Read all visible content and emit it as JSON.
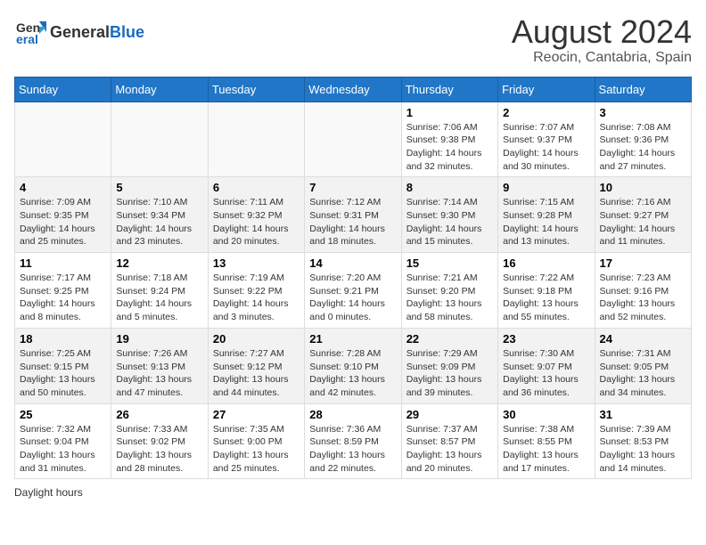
{
  "header": {
    "logo_general": "General",
    "logo_blue": "Blue",
    "title": "August 2024",
    "subtitle": "Reocin, Cantabria, Spain"
  },
  "weekdays": [
    "Sunday",
    "Monday",
    "Tuesday",
    "Wednesday",
    "Thursday",
    "Friday",
    "Saturday"
  ],
  "weeks": [
    [
      {
        "day": "",
        "info": ""
      },
      {
        "day": "",
        "info": ""
      },
      {
        "day": "",
        "info": ""
      },
      {
        "day": "",
        "info": ""
      },
      {
        "day": "1",
        "info": "Sunrise: 7:06 AM\nSunset: 9:38 PM\nDaylight: 14 hours\nand 32 minutes."
      },
      {
        "day": "2",
        "info": "Sunrise: 7:07 AM\nSunset: 9:37 PM\nDaylight: 14 hours\nand 30 minutes."
      },
      {
        "day": "3",
        "info": "Sunrise: 7:08 AM\nSunset: 9:36 PM\nDaylight: 14 hours\nand 27 minutes."
      }
    ],
    [
      {
        "day": "4",
        "info": "Sunrise: 7:09 AM\nSunset: 9:35 PM\nDaylight: 14 hours\nand 25 minutes."
      },
      {
        "day": "5",
        "info": "Sunrise: 7:10 AM\nSunset: 9:34 PM\nDaylight: 14 hours\nand 23 minutes."
      },
      {
        "day": "6",
        "info": "Sunrise: 7:11 AM\nSunset: 9:32 PM\nDaylight: 14 hours\nand 20 minutes."
      },
      {
        "day": "7",
        "info": "Sunrise: 7:12 AM\nSunset: 9:31 PM\nDaylight: 14 hours\nand 18 minutes."
      },
      {
        "day": "8",
        "info": "Sunrise: 7:14 AM\nSunset: 9:30 PM\nDaylight: 14 hours\nand 15 minutes."
      },
      {
        "day": "9",
        "info": "Sunrise: 7:15 AM\nSunset: 9:28 PM\nDaylight: 14 hours\nand 13 minutes."
      },
      {
        "day": "10",
        "info": "Sunrise: 7:16 AM\nSunset: 9:27 PM\nDaylight: 14 hours\nand 11 minutes."
      }
    ],
    [
      {
        "day": "11",
        "info": "Sunrise: 7:17 AM\nSunset: 9:25 PM\nDaylight: 14 hours\nand 8 minutes."
      },
      {
        "day": "12",
        "info": "Sunrise: 7:18 AM\nSunset: 9:24 PM\nDaylight: 14 hours\nand 5 minutes."
      },
      {
        "day": "13",
        "info": "Sunrise: 7:19 AM\nSunset: 9:22 PM\nDaylight: 14 hours\nand 3 minutes."
      },
      {
        "day": "14",
        "info": "Sunrise: 7:20 AM\nSunset: 9:21 PM\nDaylight: 14 hours\nand 0 minutes."
      },
      {
        "day": "15",
        "info": "Sunrise: 7:21 AM\nSunset: 9:20 PM\nDaylight: 13 hours\nand 58 minutes."
      },
      {
        "day": "16",
        "info": "Sunrise: 7:22 AM\nSunset: 9:18 PM\nDaylight: 13 hours\nand 55 minutes."
      },
      {
        "day": "17",
        "info": "Sunrise: 7:23 AM\nSunset: 9:16 PM\nDaylight: 13 hours\nand 52 minutes."
      }
    ],
    [
      {
        "day": "18",
        "info": "Sunrise: 7:25 AM\nSunset: 9:15 PM\nDaylight: 13 hours\nand 50 minutes."
      },
      {
        "day": "19",
        "info": "Sunrise: 7:26 AM\nSunset: 9:13 PM\nDaylight: 13 hours\nand 47 minutes."
      },
      {
        "day": "20",
        "info": "Sunrise: 7:27 AM\nSunset: 9:12 PM\nDaylight: 13 hours\nand 44 minutes."
      },
      {
        "day": "21",
        "info": "Sunrise: 7:28 AM\nSunset: 9:10 PM\nDaylight: 13 hours\nand 42 minutes."
      },
      {
        "day": "22",
        "info": "Sunrise: 7:29 AM\nSunset: 9:09 PM\nDaylight: 13 hours\nand 39 minutes."
      },
      {
        "day": "23",
        "info": "Sunrise: 7:30 AM\nSunset: 9:07 PM\nDaylight: 13 hours\nand 36 minutes."
      },
      {
        "day": "24",
        "info": "Sunrise: 7:31 AM\nSunset: 9:05 PM\nDaylight: 13 hours\nand 34 minutes."
      }
    ],
    [
      {
        "day": "25",
        "info": "Sunrise: 7:32 AM\nSunset: 9:04 PM\nDaylight: 13 hours\nand 31 minutes."
      },
      {
        "day": "26",
        "info": "Sunrise: 7:33 AM\nSunset: 9:02 PM\nDaylight: 13 hours\nand 28 minutes."
      },
      {
        "day": "27",
        "info": "Sunrise: 7:35 AM\nSunset: 9:00 PM\nDaylight: 13 hours\nand 25 minutes."
      },
      {
        "day": "28",
        "info": "Sunrise: 7:36 AM\nSunset: 8:59 PM\nDaylight: 13 hours\nand 22 minutes."
      },
      {
        "day": "29",
        "info": "Sunrise: 7:37 AM\nSunset: 8:57 PM\nDaylight: 13 hours\nand 20 minutes."
      },
      {
        "day": "30",
        "info": "Sunrise: 7:38 AM\nSunset: 8:55 PM\nDaylight: 13 hours\nand 17 minutes."
      },
      {
        "day": "31",
        "info": "Sunrise: 7:39 AM\nSunset: 8:53 PM\nDaylight: 13 hours\nand 14 minutes."
      }
    ]
  ],
  "footer": {
    "note": "Daylight hours"
  }
}
